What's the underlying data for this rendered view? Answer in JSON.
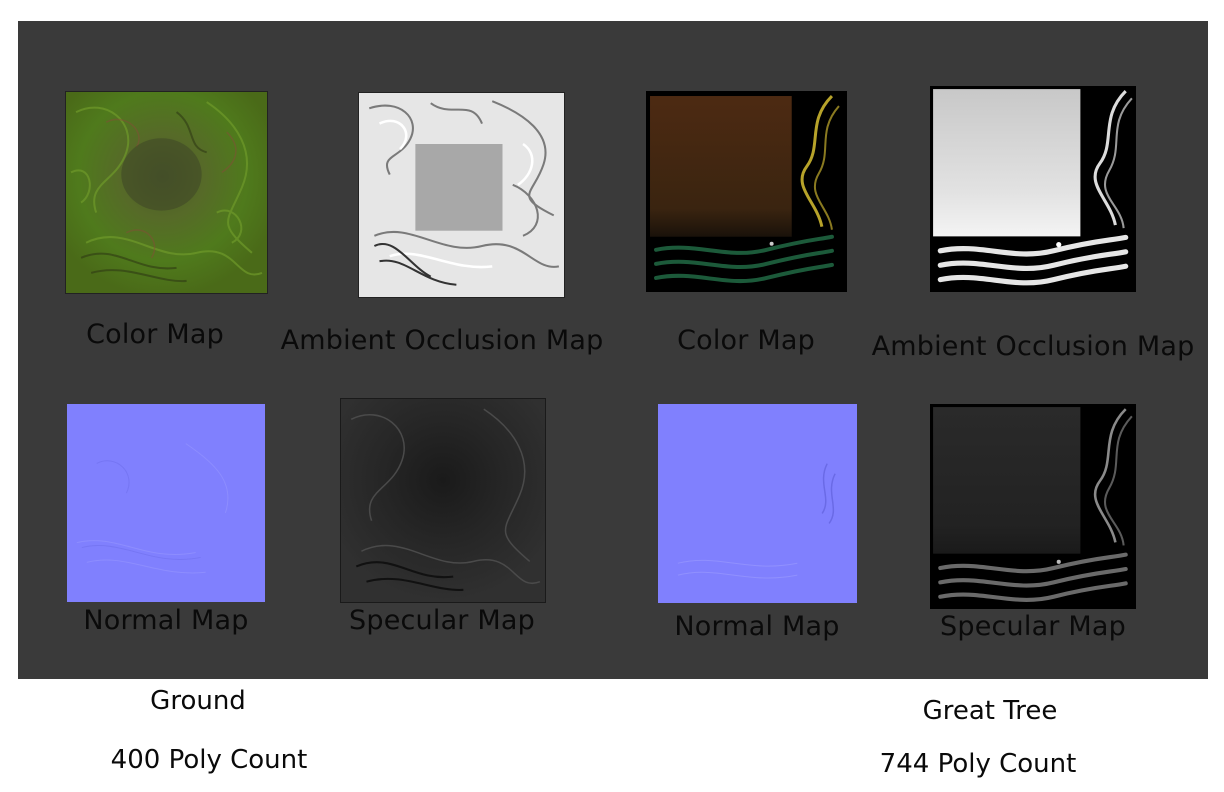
{
  "ground": {
    "color_map": "Color Map",
    "ao_map": "Ambient Occlusion Map",
    "normal_map": "Normal Map",
    "specular_map": "Specular Map",
    "name": "Ground",
    "poly_count": "400 Poly Count"
  },
  "tree": {
    "color_map": "Color Map",
    "ao_map": "Ambient Occlusion Map",
    "normal_map": "Normal Map",
    "specular_map": "Specular Map",
    "name": "Great Tree",
    "poly_count": "744 Poly Count"
  },
  "colors": {
    "panel": "#3a3a3a",
    "normal_blue": "#8080fe",
    "ground_green": "#4e6a1e",
    "bark_brown": "#4d2d12",
    "leaf_green": "#1c5a3a",
    "vine_yellow": "#b7a32a"
  }
}
